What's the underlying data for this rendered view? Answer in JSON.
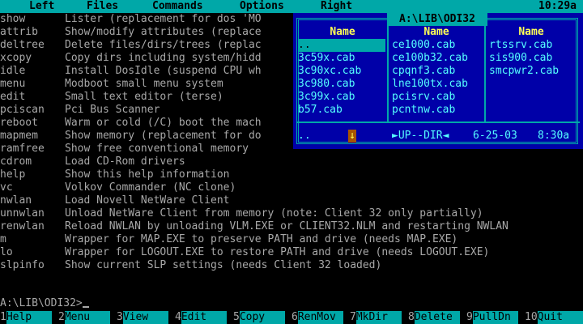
{
  "menubar": {
    "items": [
      "Left",
      "Files",
      "Commands",
      "Options",
      "Right"
    ],
    "clock": "10:29a"
  },
  "listing": [
    {
      "cmd": "show",
      "desc": "Lister (replacement for dos 'MO"
    },
    {
      "cmd": "attrib",
      "desc": "Show/modify attributes (replace"
    },
    {
      "cmd": "deltree",
      "desc": "Delete files/dirs/trees (replac"
    },
    {
      "cmd": "xcopy",
      "desc": "Copy dirs including system/hidd"
    },
    {
      "cmd": "idle",
      "desc": "Install DosIdle (suspend CPU wh"
    },
    {
      "cmd": "menu",
      "desc": "Modboot small menu system"
    },
    {
      "cmd": "edit",
      "desc": "Small text editor (terse)"
    },
    {
      "cmd": "pciscan",
      "desc": "Pci Bus Scanner"
    },
    {
      "cmd": "reboot",
      "desc": "Warm or cold (/C) boot the mach"
    },
    {
      "cmd": "mapmem",
      "desc": "Show memory (replacement for do"
    },
    {
      "cmd": "ramfree",
      "desc": "Show free conventional memory"
    },
    {
      "cmd": "cdrom",
      "desc": "Load CD-Rom drivers"
    },
    {
      "cmd": "help",
      "desc": "Show this help information"
    },
    {
      "cmd": "vc",
      "desc": "Volkov Commander (NC clone)"
    },
    {
      "cmd": "nwlan",
      "desc": "Load Novell NetWare Client"
    },
    {
      "cmd": "unnwlan",
      "desc": "Unload NetWare Client from memory (note: Client 32 only partially)"
    },
    {
      "cmd": "renwlan",
      "desc": "Reload NWLAN by unloading VLM.EXE or CLIENT32.NLM and restarting NWLAN"
    },
    {
      "cmd": "m",
      "desc": "Wrapper for MAP.EXE to preserve PATH and drive (needs MAP.EXE)"
    },
    {
      "cmd": "lo",
      "desc": "Wrapper for LOGOUT.EXE to restore PATH and drive (needs LOGOUT.EXE)"
    },
    {
      "cmd": "slpinfo",
      "desc": "Show current SLP settings (needs Client 32 loaded)"
    }
  ],
  "panel": {
    "title": "A:\\LIB\\ODI32",
    "column_header": "Name",
    "columns": [
      [
        ".. ",
        "3c59x.cab",
        "3c90xc.cab",
        "3c980.cab",
        "3c99x.cab",
        "b57.cab"
      ],
      [
        "ce1000.cab",
        "ce100b32.cab",
        "cpqnf3.cab",
        "lne100tx.cab",
        "pcisrv.cab",
        "pcntnw.cab"
      ],
      [
        "rtssrv.cab",
        "sis900.cab",
        "smcpwr2.cab"
      ]
    ],
    "selected": "..",
    "status": {
      "name": "..",
      "arrow": "↓",
      "dir_label": "►UP--DIR◄",
      "date": "6-25-03",
      "time": "8:30a"
    }
  },
  "prompt": {
    "text": "A:\\LIB\\ODI32>"
  },
  "fkeys": [
    {
      "num": "1",
      "label": "Help"
    },
    {
      "num": "2",
      "label": "Menu"
    },
    {
      "num": "3",
      "label": "View"
    },
    {
      "num": "4",
      "label": "Edit"
    },
    {
      "num": "5",
      "label": "Copy"
    },
    {
      "num": "6",
      "label": "RenMov"
    },
    {
      "num": "7",
      "label": "MkDir"
    },
    {
      "num": "8",
      "label": "Delete"
    },
    {
      "num": "9",
      "label": "PullDn"
    },
    {
      "num": "10",
      "label": "Quit"
    }
  ],
  "colors": {
    "menubar_bg": "#00a8a8",
    "panel_bg": "#0000a8",
    "panel_text": "#55ffff",
    "header_text": "#ffff55",
    "terminal_text": "#a8a8a8"
  }
}
